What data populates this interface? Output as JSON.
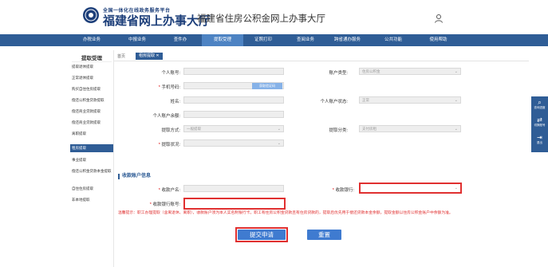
{
  "header": {
    "logo_small": "全国一体化在线政务服务平台",
    "logo_big": "福建省网上办事大厅",
    "site_title": "福建省住房公积金网上办事大厅",
    "user_icon": "user-icon"
  },
  "nav": {
    "items": [
      "办税业务",
      "中报业务",
      "查件办",
      "提取受理",
      "证照打印",
      "查阅业务",
      "跨省通办服务",
      "公共功能",
      "使用帮助"
    ],
    "active_index": 3
  },
  "sidebar": {
    "title": "提取受理",
    "items": [
      "提取退休提取",
      "正常退休提取",
      "购买自住住房提取",
      "偿还公积金贷款提取",
      "偿还商业贷款提取",
      "偿还商业贷款提取",
      "离职提取",
      "租房提取",
      "事业提取",
      "偿还公积金贷款本金提取",
      "自住住房提取",
      "非本地提取"
    ],
    "active_item": "租房提取"
  },
  "tabs": {
    "home": "首页",
    "active": "租房提取"
  },
  "form": {
    "personal_account_label": "个人账号:",
    "phone_label": "手机号码:",
    "phone_button": "获取验证码",
    "name_label": "姓名:",
    "balance_label": "个人账户余额:",
    "method_label": "提取方式:",
    "method_value": "一般提取",
    "status_label": "提取状况:",
    "account_type_label": "账户类型:",
    "account_type_value": "住房公积金",
    "account_status_label": "个人账户状态:",
    "account_status_value": "正常",
    "category_label": "提取分类:",
    "category_value": "支付房租"
  },
  "receipt": {
    "section_title": "收款账户信息",
    "payee_label": "收款户名:",
    "bank_label": "收款银行:",
    "bank_account_label": "收款银行账号:"
  },
  "notice": "温馨提示：职工办理提取（含离退休、离职），收款账户须为本人实名制银行卡。职工有住房公积金贷款且有住房贷款的，提取后优先用于偿还贷款本金余额，提取金额以住房公积金账户中余额为准。",
  "buttons": {
    "submit": "提交申请",
    "reset": "重置"
  },
  "right_panel": [
    {
      "icon": "search-icon",
      "glyph": "⌕",
      "label": "查询进度"
    },
    {
      "icon": "switch-icon",
      "glyph": "⇄",
      "label": "切换账号"
    },
    {
      "icon": "exit-icon",
      "glyph": "⇥",
      "label": "退出"
    }
  ],
  "colors": {
    "nav_bg": "#2f5d96",
    "nav_active": "#4d83c3",
    "primary_button": "#3f7bd0",
    "highlight_red": "#e03030"
  }
}
